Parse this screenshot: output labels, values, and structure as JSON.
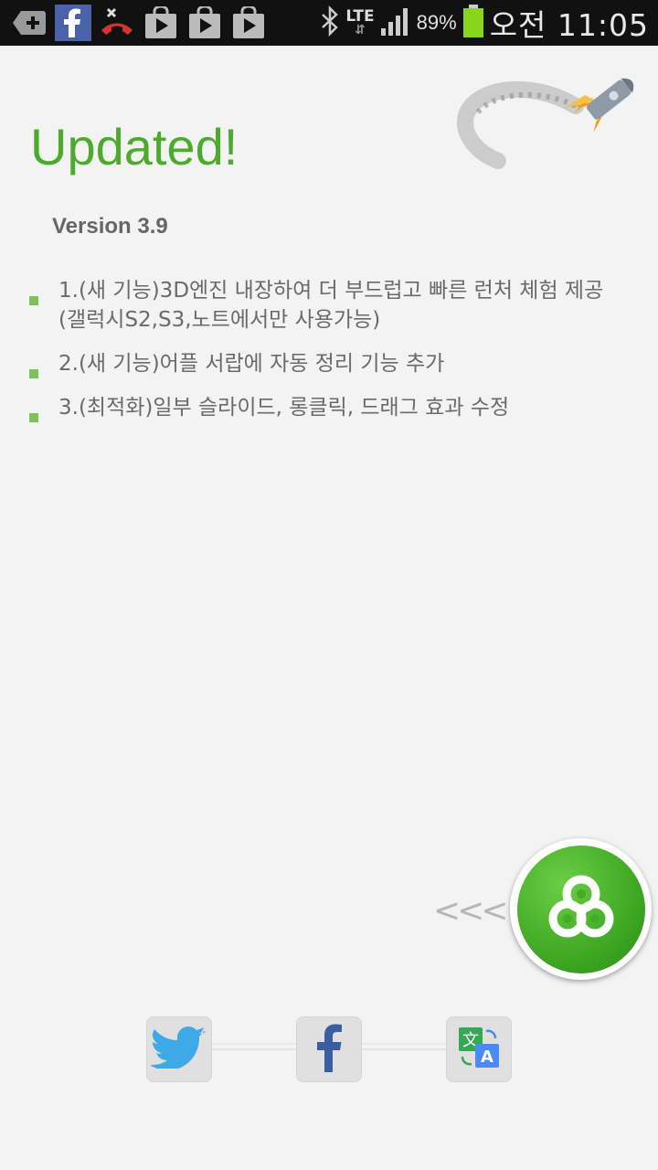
{
  "status_bar": {
    "notification_icons": [
      "add-icon",
      "facebook-icon",
      "missed-call-icon",
      "play-store-icon",
      "play-store-icon",
      "play-store-icon"
    ],
    "network": "LTE",
    "battery": "89%",
    "time": "오전 11:05"
  },
  "update": {
    "title": "Updated!",
    "version": "Version 3.9",
    "notes": [
      "1.(새 기능)3D엔진 내장하여 더 부드럽고 빠른 런처 체험 제공 (갤럭시S2,S3,노트에서만 사용가능)",
      "2.(새 기능)어플 서랍에 자동 정리 기능 추가",
      "3.(최적화)일부 슬라이드, 롱클릭, 드래그 효과 수정"
    ]
  },
  "launcher": {
    "arrows": "<<<"
  },
  "share": {
    "buttons": [
      "twitter-icon",
      "facebook-icon",
      "translate-icon"
    ]
  },
  "colors": {
    "accent": "#4caa2c",
    "bullet": "#7cc15c",
    "text": "#6a6a6a",
    "background": "#f3f3f3"
  }
}
